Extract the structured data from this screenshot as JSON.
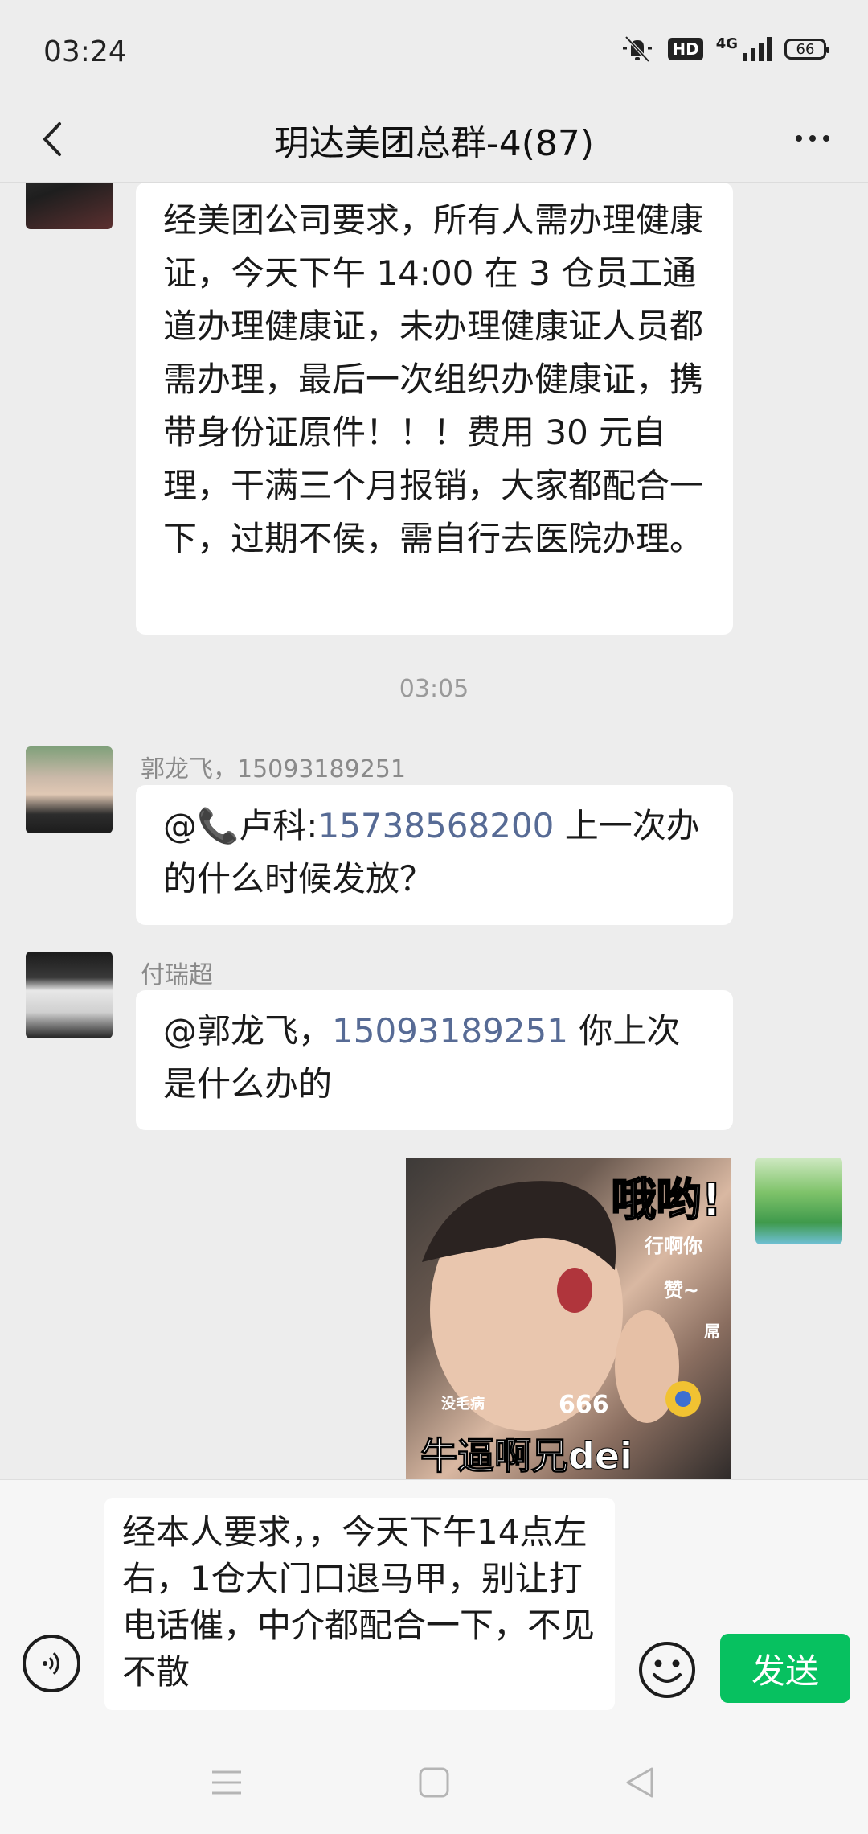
{
  "status": {
    "time": "03:24",
    "hd": "HD",
    "network": "4G",
    "battery": "66"
  },
  "header": {
    "title": "玥达美团总群-4(87)"
  },
  "messages": [
    {
      "text": "经美团公司要求，所有人需办理健康证，今天下午 14:00 在 3 仓员工通道办理健康证，未办理健康证人员都需办理，最后一次组织办健康证，携带身份证原件！！！费用 30 元自理，干满三个月报销，大家都配合一下，过期不侯，需自行去医院办理。"
    },
    {
      "timestamp": "03:05"
    },
    {
      "sender": "郭龙飞，15093189251",
      "prefix": "@📞卢科:",
      "mention": "15738568200",
      "suffix": " 上一次办的什么时候发放？"
    },
    {
      "sender": "付瑞超",
      "prefix": "@郭龙飞，",
      "mention": "15093189251",
      "suffix": " 你上次是什么办的"
    },
    {
      "sticker": {
        "title": "哦哟!",
        "line1": "行啊你",
        "line2": "赞~",
        "line3": "屌",
        "small": "没毛病",
        "number": "666",
        "caption": "牛逼啊兄dei"
      }
    }
  ],
  "composer": {
    "text": "经本人要求，，今天下午14点左右，1仓大门口退马甲，别让打电话催，中介都配合一下，不见不散",
    "send_label": "发送"
  },
  "icons": {
    "back": "back-arrow-icon",
    "more": "more-dots-icon",
    "voice": "voice-icon",
    "emoji": "emoji-icon"
  },
  "colors": {
    "send": "#07c160",
    "link": "#576b95",
    "background": "#ededed"
  }
}
